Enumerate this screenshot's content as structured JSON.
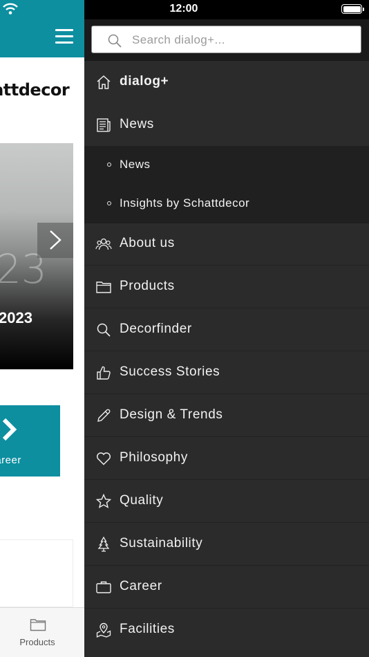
{
  "status_bar": {
    "time": "12:00"
  },
  "background": {
    "logo_text": "Schattdecor",
    "hero_number": "23",
    "hero_year": "2023",
    "career_label": "Career",
    "tabbar": {
      "products_label": "Products"
    }
  },
  "menu": {
    "search_placeholder": "Search dialog+...",
    "items": [
      {
        "label": "dialog+",
        "icon": "home-icon"
      },
      {
        "label": "News",
        "icon": "newspaper-icon"
      },
      {
        "label": "About us",
        "icon": "people-icon"
      },
      {
        "label": "Products",
        "icon": "folder-icon"
      },
      {
        "label": "Decorfinder",
        "icon": "search-icon"
      },
      {
        "label": "Success Stories",
        "icon": "thumbs-up-icon"
      },
      {
        "label": "Design & Trends",
        "icon": "pencil-icon"
      },
      {
        "label": "Philosophy",
        "icon": "heart-icon"
      },
      {
        "label": "Quality",
        "icon": "star-icon"
      },
      {
        "label": "Sustainability",
        "icon": "tree-icon"
      },
      {
        "label": "Career",
        "icon": "briefcase-icon"
      },
      {
        "label": "Facilities",
        "icon": "map-pin-icon"
      }
    ],
    "news_subitems": [
      {
        "label": "News"
      },
      {
        "label": "Insights by Schattdecor"
      }
    ]
  },
  "colors": {
    "brand_teal": "#0d8fa0",
    "menu_bg": "#2b2b2b",
    "submenu_bg": "#202020"
  }
}
